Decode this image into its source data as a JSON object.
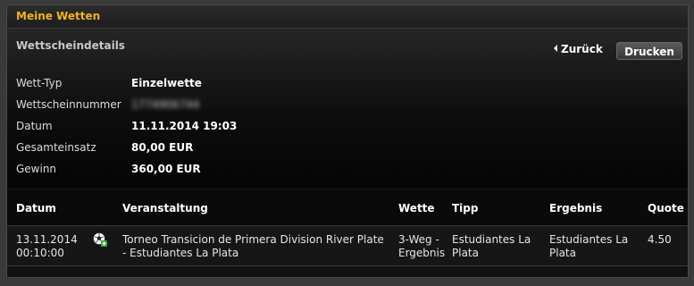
{
  "window": {
    "title": "Meine Wetten"
  },
  "details": {
    "section_title": "Wettscheindetails",
    "back_label": "Zurück",
    "print_label": "Drucken",
    "rows": [
      {
        "label": "Wett-Typ",
        "value": "Einzelwette"
      },
      {
        "label": "Wettscheinnummer",
        "value": "1774906744"
      },
      {
        "label": "Datum",
        "value": "11.11.2014 19:03"
      },
      {
        "label": "Gesamteinsatz",
        "value": "80,00 EUR"
      },
      {
        "label": "Gewinn",
        "value": "360,00 EUR"
      }
    ]
  },
  "table": {
    "headers": {
      "datum": "Datum",
      "veranstaltung": "Veranstaltung",
      "wette": "Wette",
      "tipp": "Tipp",
      "ergebnis": "Ergebnis",
      "quote": "Quote"
    },
    "rows": [
      {
        "datum_line1": "13.11.2014",
        "datum_line2": "00:10:00",
        "sport_icon": "football-icon",
        "veranstaltung_line1": "Torneo Transicion de Primera Division River Plate",
        "veranstaltung_line2": "- Estudiantes La Plata",
        "wette_line1": "3-Weg -",
        "wette_line2": "Ergebnis",
        "tipp_line1": "Estudiantes La",
        "tipp_line2": "Plata",
        "ergebnis_line1": "Estudiantes La",
        "ergebnis_line2": "Plata",
        "quote": "4.50"
      }
    ]
  },
  "colors": {
    "accent": "#f2b21e",
    "background": "#111111"
  }
}
